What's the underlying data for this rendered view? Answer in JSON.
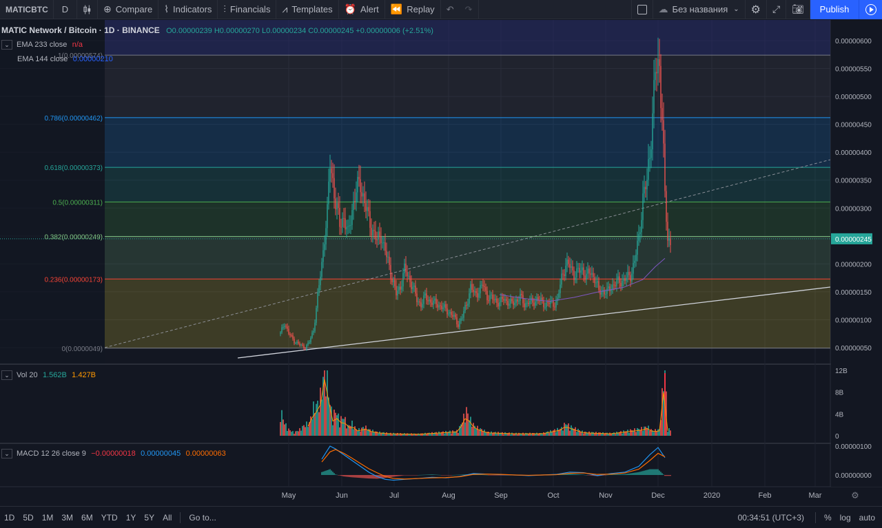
{
  "toolbar": {
    "symbol": "MATICBTC",
    "interval": "D",
    "compare": "Compare",
    "indicators": "Indicators",
    "financials": "Financials",
    "templates": "Templates",
    "alert": "Alert",
    "replay": "Replay",
    "layout_name": "Без названия",
    "publish": "Publish"
  },
  "legend": {
    "title": "MATIC Network / Bitcoin · 1D · BINANCE",
    "ohlc": "O0.00000239 H0.00000270 L0.00000234 C0.00000245 +0.00000006 (+2.51%)",
    "ema233_label": "EMA 233 close",
    "ema233_value": "n/a",
    "ema144_label": "EMA 144 close",
    "ema144_value": "0.00000210",
    "vol_label": "Vol 20",
    "vol_v1": "1.562B",
    "vol_v2": "1.427B",
    "macd_label": "MACD 12 26 close 9",
    "macd_v1": "−0.00000018",
    "macd_v2": "0.00000045",
    "macd_v3": "0.00000063"
  },
  "fib": [
    {
      "label": "1(0.00000574)",
      "value": 5.74e-06,
      "color": "#787b86"
    },
    {
      "label": "0.786(0.00000462)",
      "value": 4.62e-06,
      "color": "#2196f3"
    },
    {
      "label": "0.618(0.00000373)",
      "value": 3.73e-06,
      "color": "#26a69a"
    },
    {
      "label": "0.5(0.00000311)",
      "value": 3.11e-06,
      "color": "#4caf50"
    },
    {
      "label": "0.382(0.00000249)",
      "value": 2.49e-06,
      "color": "#81c784"
    },
    {
      "label": "0.236(0.00000173)",
      "value": 1.73e-06,
      "color": "#f44336"
    },
    {
      "label": "0(0.0000049)",
      "value": 4.9e-07,
      "color": "#787b86"
    }
  ],
  "price_axis": {
    "ticks": [
      "0.00000600",
      "0.00000550",
      "0.00000500",
      "0.00000450",
      "0.00000400",
      "0.00000350",
      "0.00000300",
      "0.00000250",
      "0.00000200",
      "0.00000150",
      "0.00000100",
      "0.00000050"
    ],
    "tick_values": [
      600,
      550,
      500,
      450,
      400,
      350,
      300,
      250,
      200,
      150,
      100,
      50
    ],
    "current_price": "0.00000245",
    "current_value": 245
  },
  "vol_axis": {
    "ticks": [
      "12B",
      "8B",
      "4B",
      "0"
    ],
    "tick_values": [
      12,
      8,
      4,
      0
    ]
  },
  "macd_axis": {
    "ticks": [
      "0.00000100",
      "0.00000000"
    ],
    "tick_values": [
      100,
      0
    ]
  },
  "time_axis": [
    "May",
    "Jun",
    "Jul",
    "Aug",
    "Sep",
    "Oct",
    "Nov",
    "Dec",
    "2020",
    "Feb",
    "Mar"
  ],
  "bottom": {
    "ranges": [
      "1D",
      "5D",
      "1M",
      "3M",
      "6M",
      "YTD",
      "1Y",
      "5Y",
      "All"
    ],
    "goto": "Go to...",
    "clock": "00:34:51 (UTC+3)",
    "opt_percent": "%",
    "opt_log": "log",
    "opt_auto": "auto"
  },
  "chart_data": {
    "type": "candlestick",
    "title": "MATIC Network / Bitcoin · 1D · BINANCE",
    "ylim": [
      30,
      615
    ],
    "price_series": [
      [
        0,
        75
      ],
      [
        3,
        95
      ],
      [
        6,
        75
      ],
      [
        10,
        62
      ],
      [
        14,
        55
      ],
      [
        18,
        50
      ],
      [
        21,
        60
      ],
      [
        24,
        82
      ],
      [
        27,
        140
      ],
      [
        30,
        200
      ],
      [
        32,
        250
      ],
      [
        34,
        290
      ],
      [
        36,
        380
      ],
      [
        38,
        350
      ],
      [
        40,
        310
      ],
      [
        43,
        270
      ],
      [
        46,
        285
      ],
      [
        49,
        250
      ],
      [
        52,
        300
      ],
      [
        55,
        330
      ],
      [
        58,
        345
      ],
      [
        61,
        310
      ],
      [
        64,
        280
      ],
      [
        67,
        260
      ],
      [
        70,
        240
      ],
      [
        73,
        255
      ],
      [
        75,
        230
      ],
      [
        78,
        205
      ],
      [
        81,
        175
      ],
      [
        84,
        145
      ],
      [
        87,
        160
      ],
      [
        90,
        190
      ],
      [
        93,
        175
      ],
      [
        96,
        160
      ],
      [
        99,
        135
      ],
      [
        102,
        128
      ],
      [
        105,
        140
      ],
      [
        108,
        135
      ],
      [
        111,
        130
      ],
      [
        114,
        128
      ],
      [
        117,
        123
      ],
      [
        120,
        118
      ],
      [
        123,
        112
      ],
      [
        126,
        104
      ],
      [
        129,
        92
      ],
      [
        132,
        105
      ],
      [
        135,
        128
      ],
      [
        138,
        158
      ],
      [
        141,
        145
      ],
      [
        144,
        152
      ],
      [
        147,
        162
      ],
      [
        150,
        142
      ],
      [
        153,
        138
      ],
      [
        156,
        135
      ],
      [
        159,
        130
      ],
      [
        162,
        138
      ],
      [
        165,
        132
      ],
      [
        168,
        128
      ],
      [
        171,
        135
      ],
      [
        174,
        140
      ],
      [
        177,
        128
      ],
      [
        180,
        132
      ],
      [
        183,
        130
      ],
      [
        186,
        138
      ],
      [
        189,
        132
      ],
      [
        192,
        128
      ],
      [
        195,
        130
      ],
      [
        198,
        128
      ],
      [
        201,
        135
      ],
      [
        204,
        175
      ],
      [
        207,
        200
      ],
      [
        210,
        195
      ],
      [
        213,
        182
      ],
      [
        216,
        185
      ],
      [
        219,
        190
      ],
      [
        222,
        178
      ],
      [
        225,
        185
      ],
      [
        228,
        175
      ],
      [
        231,
        150
      ],
      [
        234,
        152
      ],
      [
        237,
        148
      ],
      [
        240,
        160
      ],
      [
        243,
        165
      ],
      [
        246,
        168
      ],
      [
        249,
        172
      ],
      [
        252,
        175
      ],
      [
        254,
        180
      ],
      [
        257,
        205
      ],
      [
        260,
        245
      ],
      [
        263,
        320
      ],
      [
        266,
        345
      ],
      [
        268,
        400
      ],
      [
        270,
        470
      ],
      [
        272,
        540
      ],
      [
        275,
        555
      ],
      [
        277,
        470
      ],
      [
        279,
        320
      ],
      [
        281,
        240
      ],
      [
        283,
        245
      ]
    ],
    "volume_B": [
      [
        0,
        4.2
      ],
      [
        3,
        2
      ],
      [
        6,
        1
      ],
      [
        10,
        0.5
      ],
      [
        14,
        1
      ],
      [
        18,
        1.8
      ],
      [
        21,
        2
      ],
      [
        24,
        4.5
      ],
      [
        27,
        5
      ],
      [
        30,
        7
      ],
      [
        32,
        11.5
      ],
      [
        34,
        9
      ],
      [
        36,
        5
      ],
      [
        38,
        3
      ],
      [
        40,
        4
      ],
      [
        43,
        2.5
      ],
      [
        46,
        3
      ],
      [
        49,
        1.5
      ],
      [
        52,
        2
      ],
      [
        55,
        1
      ],
      [
        58,
        1
      ],
      [
        61,
        1.5
      ],
      [
        64,
        1
      ],
      [
        70,
        0.6
      ],
      [
        80,
        0.4
      ],
      [
        100,
        0.3
      ],
      [
        129,
        0.8
      ],
      [
        135,
        4
      ],
      [
        138,
        2.5
      ],
      [
        141,
        1.5
      ],
      [
        150,
        0.6
      ],
      [
        170,
        0.4
      ],
      [
        190,
        0.4
      ],
      [
        204,
        1.2
      ],
      [
        207,
        2
      ],
      [
        210,
        1.5
      ],
      [
        220,
        0.6
      ],
      [
        240,
        0.4
      ],
      [
        263,
        1.2
      ],
      [
        266,
        1.5
      ],
      [
        270,
        0.8
      ],
      [
        275,
        1.0
      ],
      [
        279,
        11.5
      ],
      [
        281,
        1.0
      ]
    ],
    "ema144": [
      [
        159,
        145
      ],
      [
        177,
        138
      ],
      [
        195,
        133
      ],
      [
        213,
        140
      ],
      [
        231,
        150
      ],
      [
        249,
        158
      ],
      [
        263,
        172
      ],
      [
        272,
        195
      ],
      [
        279,
        210
      ]
    ],
    "macd_line": [
      [
        30,
        55
      ],
      [
        36,
        100
      ],
      [
        40,
        90
      ],
      [
        46,
        70
      ],
      [
        52,
        50
      ],
      [
        58,
        30
      ],
      [
        64,
        10
      ],
      [
        70,
        -5
      ],
      [
        76,
        -15
      ],
      [
        82,
        -18
      ],
      [
        90,
        -15
      ],
      [
        100,
        -12
      ],
      [
        110,
        -8
      ],
      [
        120,
        -10
      ],
      [
        130,
        -5
      ],
      [
        140,
        5
      ],
      [
        150,
        3
      ],
      [
        160,
        1
      ],
      [
        170,
        0
      ],
      [
        180,
        -2
      ],
      [
        190,
        0
      ],
      [
        200,
        2
      ],
      [
        210,
        10
      ],
      [
        220,
        8
      ],
      [
        230,
        -2
      ],
      [
        240,
        5
      ],
      [
        250,
        10
      ],
      [
        260,
        30
      ],
      [
        268,
        70
      ],
      [
        274,
        95
      ],
      [
        279,
        60
      ]
    ],
    "signal_line": [
      [
        30,
        45
      ],
      [
        36,
        80
      ],
      [
        40,
        88
      ],
      [
        46,
        75
      ],
      [
        52,
        58
      ],
      [
        58,
        40
      ],
      [
        64,
        22
      ],
      [
        70,
        8
      ],
      [
        76,
        -5
      ],
      [
        82,
        -12
      ],
      [
        90,
        -14
      ],
      [
        100,
        -12
      ],
      [
        110,
        -10
      ],
      [
        120,
        -9
      ],
      [
        130,
        -6
      ],
      [
        140,
        2
      ],
      [
        150,
        3
      ],
      [
        160,
        2
      ],
      [
        170,
        0
      ],
      [
        180,
        -1
      ],
      [
        190,
        0
      ],
      [
        200,
        1
      ],
      [
        210,
        6
      ],
      [
        220,
        7
      ],
      [
        230,
        2
      ],
      [
        240,
        3
      ],
      [
        250,
        7
      ],
      [
        260,
        20
      ],
      [
        268,
        50
      ],
      [
        274,
        75
      ],
      [
        279,
        63
      ]
    ]
  }
}
